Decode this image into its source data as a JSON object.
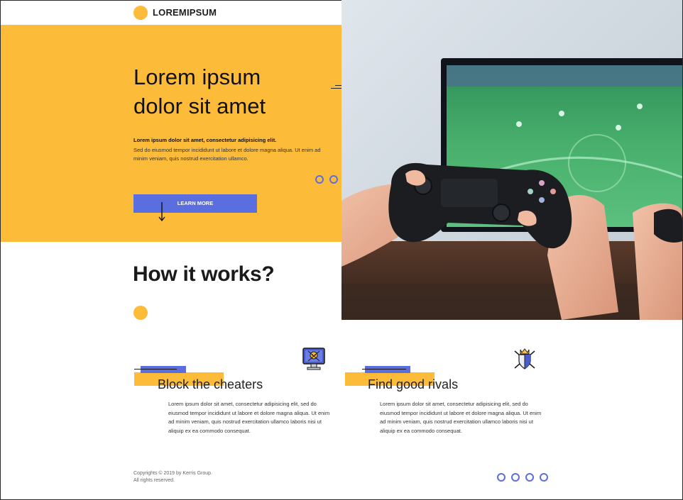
{
  "brand": {
    "name": "LOREMIPSUM"
  },
  "hero": {
    "title_line1": "Lorem ipsum",
    "title_line2": "dolor sit amet",
    "lead": "Lorem ipsum dolor sit amet, consectetur adipisicing elit.",
    "body": "Sed do eiusmod tempor incididunt ut labore et dolore magna aliqua. Ut enim ad minim veniam, quis nostrud exercitation ullamco.",
    "cta_label": "LEARN MORE"
  },
  "how": {
    "title": "How it works?"
  },
  "features": [
    {
      "title": "Block the cheaters",
      "body": "Lorem ipsum dolor sit amet, consectetur adipisicing elit, sed do eiusmod tempor incididunt ut labore et dolore magna aliqua. Ut enim ad minim veniam, quis nostrud exercitation ullamco laboris nisi ut aliquip ex ea commodo consequat.",
      "icon": "monitor-skull-icon"
    },
    {
      "title": "Find good rivals",
      "body": "Lorem ipsum dolor sit amet, consectetur adipisicing elit, sed do eiusmod tempor incididunt ut labore et dolore magna aliqua. Ut enim ad minim veniam, quis nostrud exercitation ullamco laboris nisi ut aliquip ex ea commodo consequat.",
      "icon": "crowned-shield-swords-icon"
    }
  ],
  "footer": {
    "copyright_line1": "Copyrights © 2019 by Kerris Group.",
    "copyright_line2": "All rights reserved."
  },
  "colors": {
    "accent_yellow": "#fdbb3a",
    "accent_blue": "#5b6ee0",
    "text_dark": "#1d1d1f"
  }
}
